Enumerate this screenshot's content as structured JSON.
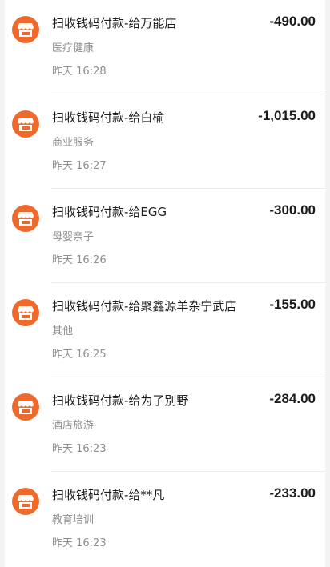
{
  "transactions": [
    {
      "title": "扫收钱码付款-给万能店",
      "amount": "-490.00",
      "category": "医疗健康",
      "time": "昨天 16:28"
    },
    {
      "title": "扫收钱码付款-给白榆",
      "amount": "-1,015.00",
      "category": "商业服务",
      "time": "昨天 16:27"
    },
    {
      "title": "扫收钱码付款-给EGG",
      "amount": "-300.00",
      "category": "母婴亲子",
      "time": "昨天 16:26"
    },
    {
      "title": "扫收钱码付款-给聚鑫源羊杂宁武店",
      "amount": "-155.00",
      "category": "其他",
      "time": "昨天 16:25"
    },
    {
      "title": "扫收钱码付款-给为了别野",
      "amount": "-284.00",
      "category": "酒店旅游",
      "time": "昨天 16:23"
    },
    {
      "title": "扫收钱码付款-给**凡",
      "amount": "-233.00",
      "category": "教育培训",
      "time": "昨天 16:23"
    }
  ],
  "icon": {
    "name": "store-icon",
    "color": "#ee6a2c"
  }
}
